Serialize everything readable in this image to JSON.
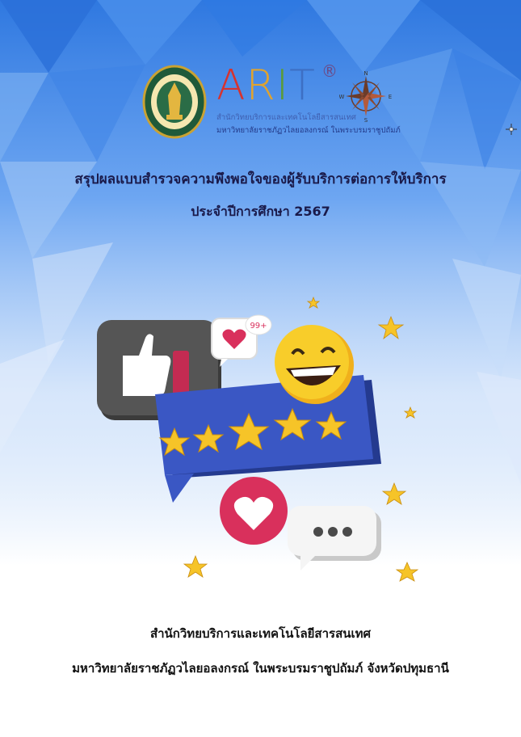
{
  "logo": {
    "brand_letters": [
      "A",
      "R",
      "I",
      "T"
    ],
    "brand_colors": [
      "#d6332f",
      "#e0a32e",
      "#5a9a3c",
      "#3d6fc4"
    ],
    "registered_mark": "®",
    "line1": "สำนักวิทยบริการและเทคโนโลยีสารสนเทศ",
    "line2": "มหาวิทยาลัยราชภัฏวไลยอลงกรณ์ ในพระบรมราชูปถัมภ์",
    "compass": {
      "n": "N",
      "s": "S",
      "e": "E",
      "w": "W"
    }
  },
  "title": "สรุปผลแบบสำรวจความพึงพอใจของผู้รับบริการต่อการให้บริการ",
  "subtitle": "ประจำปีการศึกษา 2567",
  "illustration": {
    "badge_text": "99+"
  },
  "footer": {
    "line1": "สำนักวิทยบริการและเทคโนโลยีสารสนเทศ",
    "line2": "มหาวิทยาลัยราชภัฏวไลยอลงกรณ์ ในพระบรมราชูปถัมภ์ จังหวัดปทุมธานี"
  },
  "colors": {
    "bg_blue": "#3f86e4",
    "title_text": "#1a1a4a",
    "card_blue": "#3a57c4",
    "star_yellow": "#f6c428",
    "heart_red": "#d9305c",
    "thumb_gray": "#4a4a4a"
  }
}
